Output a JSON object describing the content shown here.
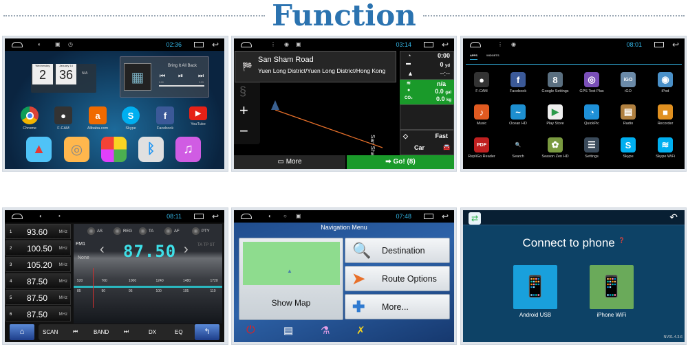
{
  "page": {
    "title": "Function",
    "accent": "#2b73b0"
  },
  "home_screen": {
    "status_time": "02:36",
    "clock": {
      "day_name": "Wednesday",
      "hour": "2",
      "date_label": "January 14",
      "minute": "36",
      "weather": "N/A"
    },
    "music": {
      "track": "Bring It All Back",
      "elapsed": "0:00",
      "duration": "3:33"
    },
    "apps": [
      "Chrome",
      "F-CAM",
      "Alibaba.com",
      "Skype",
      "Facebook",
      "YouTube"
    ],
    "dock": [
      "navigation-icon",
      "settings-icon",
      "apps-icon",
      "bluetooth-icon",
      "music-icon"
    ]
  },
  "navigation": {
    "status_time": "03:14",
    "street": "San Sham Road",
    "district": "Yuen Long District/Yuen Long District/Hong Kong",
    "eta": "0:00",
    "distance": "0",
    "distance_unit": "yd",
    "arrival": "--:--",
    "cost": "n/a",
    "fuel": "0.0",
    "fuel_unit": "gal",
    "co2_label": "CO₂",
    "co2": "0.0",
    "co2_unit": "kg",
    "route_type": "Fast",
    "vehicle": "Car",
    "map_label": "San Sham",
    "more": "More",
    "go": "Go! (8)"
  },
  "app_drawer": {
    "status_time": "08:01",
    "tabs": [
      "APPS",
      "WIDGETS"
    ],
    "apps": [
      {
        "label": "F-CAM",
        "color": "#333",
        "glyph": "●"
      },
      {
        "label": "Facebook",
        "color": "#3b5998",
        "glyph": "f"
      },
      {
        "label": "Google Settings",
        "color": "#5a6f80",
        "glyph": "8"
      },
      {
        "label": "GPS Test Plus",
        "color": "#7a4fb8",
        "glyph": "◎"
      },
      {
        "label": "iGO",
        "color": "#6b8aa8",
        "glyph": "iGO"
      },
      {
        "label": "iPod",
        "color": "#4a90c8",
        "glyph": "◉"
      },
      {
        "label": "Music",
        "color": "#e05a20",
        "glyph": "♪"
      },
      {
        "label": "Ocean HD",
        "color": "#1d8fd0",
        "glyph": "~"
      },
      {
        "label": "Play Store",
        "color": "#eeeeee",
        "glyph": "▶"
      },
      {
        "label": "QuickPic",
        "color": "#1e90d8",
        "glyph": "◔"
      },
      {
        "label": "Radio",
        "color": "#b08040",
        "glyph": "▤"
      },
      {
        "label": "Recorder",
        "color": "#e09020",
        "glyph": "■"
      },
      {
        "label": "RepliGo Reader",
        "color": "#c02020",
        "glyph": "PDF"
      },
      {
        "label": "Search",
        "color": "#000000",
        "glyph": "🔍"
      },
      {
        "label": "Season Zen HD",
        "color": "#7a9a40",
        "glyph": "✿"
      },
      {
        "label": "Settings",
        "color": "#3a4a5a",
        "glyph": "☰"
      },
      {
        "label": "Skype",
        "color": "#00aff0",
        "glyph": "S"
      },
      {
        "label": "Skype WiFi",
        "color": "#00aff0",
        "glyph": "≋"
      }
    ]
  },
  "radio": {
    "status_time": "08:11",
    "presets": [
      {
        "num": "1",
        "freq": "93.60"
      },
      {
        "num": "2",
        "freq": "100.50"
      },
      {
        "num": "3",
        "freq": "105.20"
      },
      {
        "num": "4",
        "freq": "87.50"
      },
      {
        "num": "5",
        "freq": "87.50"
      },
      {
        "num": "6",
        "freq": "87.50"
      }
    ],
    "unit": "MHz",
    "toggles": [
      "AS",
      "REG",
      "TA",
      "AF",
      "PTY"
    ],
    "band": "FM1",
    "station": "None",
    "frequency": "87.50",
    "indicators": "TA TP ST",
    "am_scale": [
      "520",
      "760",
      "1000",
      "1240",
      "1480",
      "1720"
    ],
    "fm_scale": [
      "85",
      "90",
      "95",
      "100",
      "105",
      "110"
    ],
    "controls": [
      "SCAN",
      "BAND",
      "DX",
      "EQ"
    ]
  },
  "nav_menu": {
    "status_time": "07:48",
    "title": "Navigation Menu",
    "show_map": "Show Map",
    "buttons": [
      "Destination",
      "Route Options",
      "More..."
    ]
  },
  "phone_link": {
    "title": "Connect to phone",
    "options": [
      "Android USB",
      "iPhone WiFi"
    ],
    "version": "NV01.4.3.6"
  }
}
